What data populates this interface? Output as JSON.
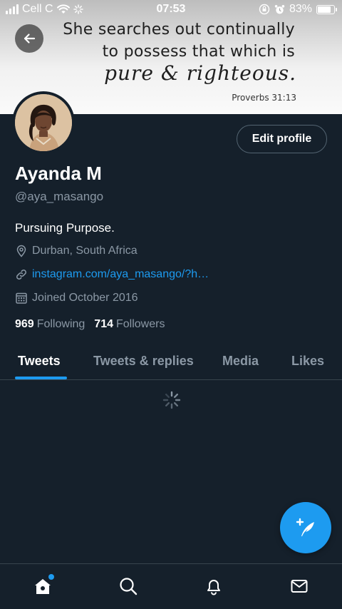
{
  "status_bar": {
    "carrier": "Cell C",
    "time": "07:53",
    "battery": "83%",
    "battery_level": 0.83
  },
  "banner": {
    "line1": "She searches out continually",
    "line2": "to possess that which is",
    "line3": "pure & righteous.",
    "reference": "Proverbs 31:13"
  },
  "profile": {
    "edit_label": "Edit profile",
    "name": "Ayanda M",
    "handle": "@aya_masango",
    "bio": "Pursuing Purpose.",
    "location": "Durban, South Africa",
    "website": "instagram.com/aya_masango/?h…",
    "joined": "Joined October 2016",
    "following_count": "969",
    "following_label": "Following",
    "followers_count": "714",
    "followers_label": "Followers"
  },
  "tabs": [
    {
      "label": "Tweets",
      "active": true
    },
    {
      "label": "Tweets & replies",
      "active": false
    },
    {
      "label": "Media",
      "active": false
    },
    {
      "label": "Likes",
      "active": false
    }
  ],
  "icons": {
    "back": "arrow-left-icon",
    "location": "map-pin-icon",
    "link": "link-icon",
    "calendar": "calendar-icon",
    "loading": "spinner-icon",
    "compose": "feather-plus-icon",
    "nav": [
      "home-icon",
      "search-icon",
      "bell-icon",
      "mail-icon"
    ]
  },
  "colors": {
    "background": "#15202b",
    "accent": "#1d9bf0",
    "secondary_text": "#8b98a5",
    "border": "#38444d"
  }
}
